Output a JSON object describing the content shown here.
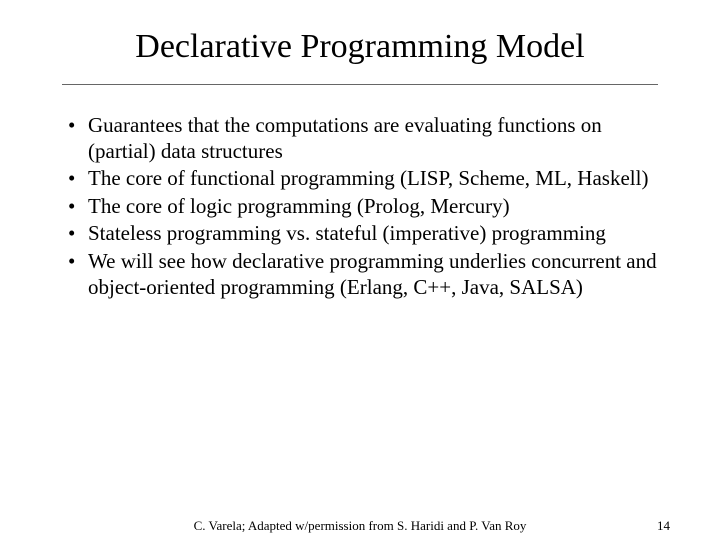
{
  "title": "Declarative Programming Model",
  "bullets": [
    "Guarantees that the computations are evaluating functions on (partial) data structures",
    "The core of functional programming (LISP, Scheme, ML, Haskell)",
    "The core of logic programming (Prolog, Mercury)",
    "Stateless programming vs. stateful (imperative) programming",
    "We will see how declarative programming underlies concurrent and object-oriented programming (Erlang, C++, Java, SALSA)"
  ],
  "footer": {
    "credit": "C. Varela; Adapted w/permission from S. Haridi and P. Van Roy",
    "page": "14"
  }
}
